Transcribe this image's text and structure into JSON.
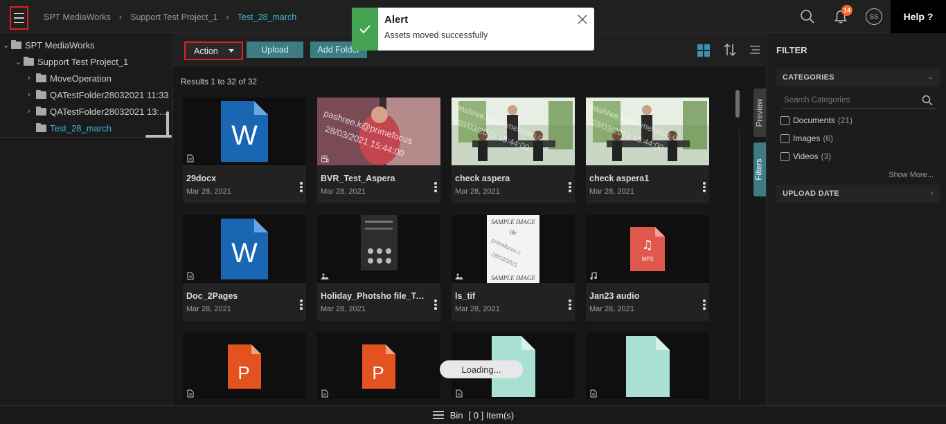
{
  "header": {
    "menu_icon": "hamburger-icon",
    "breadcrumb": [
      "SPT MediaWorks",
      "Support Test Project_1",
      "Test_28_march"
    ],
    "notification_count": "14",
    "avatar_initials": "SS",
    "help_label": "Help ?"
  },
  "tree": {
    "items": [
      {
        "label": "SPT MediaWorks",
        "expanded": true
      },
      {
        "label": "Support Test Project_1",
        "expanded": true
      },
      {
        "label": "MoveOperation",
        "expanded": false
      },
      {
        "label": "QATestFolder28032021 11:33",
        "expanded": false
      },
      {
        "label": "QATestFolder28032021 13:...",
        "expanded": false
      },
      {
        "label": "Test_28_march",
        "selected": true
      }
    ]
  },
  "toolbar": {
    "action_label": "Action",
    "upload_label": "Upload",
    "add_folder_label": "Add Folder"
  },
  "results_text": "Results 1 to 32 of 32",
  "assets": [
    {
      "name": "29docx",
      "date": "Mar 28, 2021",
      "kind": "document",
      "thumb": "word"
    },
    {
      "name": "BVR_Test_Aspera",
      "date": "Mar 28, 2021",
      "kind": "video",
      "thumb": "video-pink"
    },
    {
      "name": "check aspera",
      "date": "Mar 28, 2021",
      "kind": "video",
      "thumb": "video-office"
    },
    {
      "name": "check aspera1",
      "date": "Mar 28, 2021",
      "kind": "video",
      "thumb": "video-office"
    },
    {
      "name": "Doc_2Pages",
      "date": "Mar 28, 2021",
      "kind": "document",
      "thumb": "word"
    },
    {
      "name": "Holiday_Photsho file_Te...",
      "date": "Mar 28, 2021",
      "kind": "image",
      "thumb": "phone"
    },
    {
      "name": "ls_tif",
      "date": "Mar 28, 2021",
      "kind": "image",
      "thumb": "tif"
    },
    {
      "name": "Jan23 audio",
      "date": "Mar 28, 2021",
      "kind": "audio",
      "thumb": "mp3"
    },
    {
      "name": "",
      "date": "",
      "kind": "document",
      "thumb": "ppt"
    },
    {
      "name": "",
      "date": "",
      "kind": "document",
      "thumb": "ppt"
    },
    {
      "name": "",
      "date": "",
      "kind": "document",
      "thumb": "blank"
    },
    {
      "name": "",
      "date": "",
      "kind": "document",
      "thumb": "blank"
    }
  ],
  "thumb_text": {
    "word_letter": "W",
    "ppt_letter": "P",
    "mp3_label": "MP3",
    "watermark_1": "pashree.k@primefocus.c 28/03/2021 15:44:00",
    "tif_top": "SAMPLE IMAGE",
    "tif_bottom": "SAMPLE IMAGE",
    "tif_mid": "file"
  },
  "side_tabs": {
    "preview": "Preview",
    "filters": "Filters"
  },
  "loading_text": "Loading...",
  "filter": {
    "title": "FILTER",
    "categories_label": "CATEGORIES",
    "search_placeholder": "Search Categories",
    "options": [
      {
        "label": "Documents",
        "count": "(21)"
      },
      {
        "label": "Images",
        "count": "(6)"
      },
      {
        "label": "Videos",
        "count": "(3)"
      }
    ],
    "show_more": "Show More...",
    "upload_date_label": "UPLOAD DATE"
  },
  "bin": {
    "label": "Bin",
    "count_text": "[ 0 ] Item(s)"
  },
  "alert": {
    "title": "Alert",
    "message": "Assets moved successfully"
  },
  "colors": {
    "accent": "#3fb6d6",
    "teal_button": "#3d7b85",
    "highlight_red": "#e0201f",
    "success": "#44a454"
  }
}
